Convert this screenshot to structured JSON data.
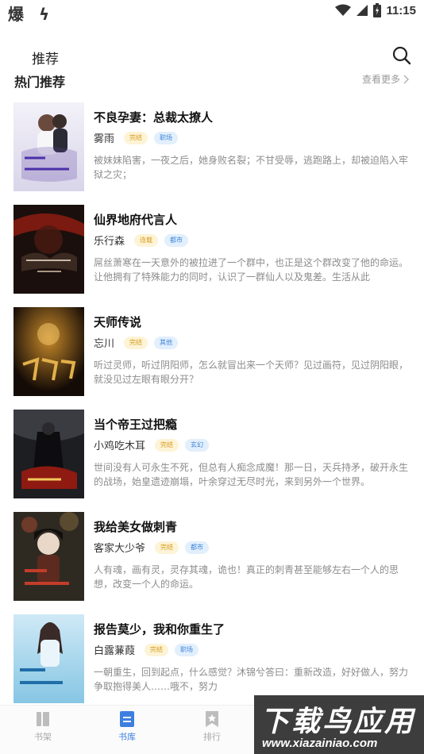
{
  "status_bar": {
    "left_icons": "爆 ϟ",
    "time": "11:15",
    "icons": [
      "wifi-icon",
      "signal-icon",
      "battery-icon"
    ]
  },
  "header": {
    "title": "推荐",
    "search_icon": "search-icon"
  },
  "section": {
    "title": "热门推荐",
    "more": "查看更多"
  },
  "books": [
    {
      "title": "不良孕妻：总裁太撩人",
      "author": "雾雨",
      "status": "完结",
      "category": "职场",
      "desc": "被妹妹陷害，一夜之后，她身败名裂；不甘受辱，逃跑路上，却被迫陷入牢狱之灾；"
    },
    {
      "title": "仙界地府代言人",
      "author": "乐行森",
      "status": "连载",
      "category": "都市",
      "desc": "屌丝萧寒在一天意外的被拉进了一个群中，也正是这个群改变了他的命运。让他拥有了特殊能力的同时，认识了一群仙人以及鬼差。生活从此"
    },
    {
      "title": "天师传说",
      "author": "忘川",
      "status": "完结",
      "category": "其他",
      "desc": "听过灵师，听过阴阳师，怎么就冒出来一个天师？见过画符，见过阴阳眼，就没见过左眼有眼分开？"
    },
    {
      "title": "当个帝王过把瘾",
      "author": "小鸡吃木耳",
      "status": "完结",
      "category": "玄幻",
      "desc": "世间没有人可永生不死，但总有人痴念成魔！那一日，天兵持矛，破开永生的战场，始皇遗迹崩塌，叶余穿过无尽时光，来到另外一个世界。"
    },
    {
      "title": "我给美女做刺青",
      "author": "客家大少爷",
      "status": "完结",
      "category": "都市",
      "desc": "人有魂，画有灵，灵存其魂，诡也！真正的刺青甚至能够左右一个人的思想，改变一个人的命运。"
    },
    {
      "title": "报告莫少，我和你重生了",
      "author": "白露蒹葭",
      "status": "完结",
      "category": "职场",
      "desc": "一朝重生，回到起点，什么感觉？沐锦兮答曰：重新改造，好好做人，努力争取抱得美人……哦不，努力"
    }
  ],
  "tabbar": {
    "items": [
      {
        "label": "书架",
        "icon": "bookshelf-icon"
      },
      {
        "label": "书库",
        "icon": "library-icon"
      },
      {
        "label": "排行",
        "icon": "ranking-icon"
      }
    ]
  },
  "watermark": {
    "main": "下载鸟应用",
    "url": "www.xiazainiao.com"
  },
  "colors": {
    "accent": "#3d7fe0",
    "status_tag_bg": "#fdf3d6",
    "status_tag_fg": "#d79b1a",
    "category_tag_bg": "#e2effc",
    "category_tag_fg": "#3f85d8"
  }
}
